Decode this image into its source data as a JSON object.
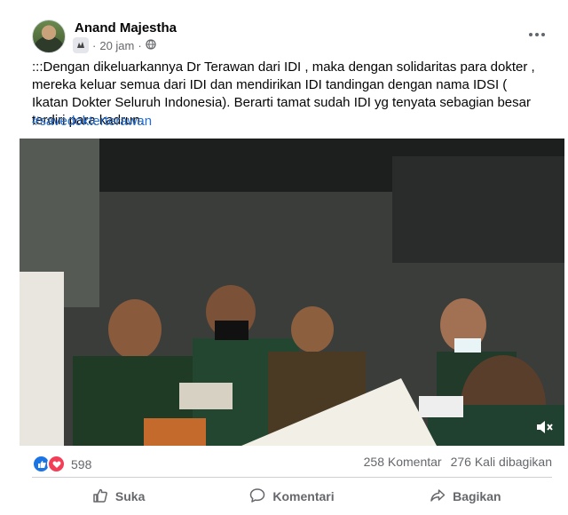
{
  "post": {
    "author": "Anand Majestha",
    "time": "20 jam",
    "separator": "·",
    "text": ":::Dengan dikeluarkannya Dr Terawan dari IDI , maka dengan solidaritas para dokter , mereka keluar semua dari IDI dan mendirikan IDI tandingan dengan nama IDSI ( Ikatan Dokter Seluruh Indonesia). Berarti tamat sudah IDI yg tenyata sebagian besar terdiri para kadrun.",
    "hashtag": "#savedokterterawan"
  },
  "stats": {
    "reactions_count": "598",
    "comments": "258 Komentar",
    "shares": "276 Kali dibagikan"
  },
  "actions": {
    "like": "Suka",
    "comment": "Komentari",
    "share": "Bagikan"
  },
  "colors": {
    "link": "#216fdb",
    "like_blue": "#1b74e4",
    "love_red": "#f33e58",
    "secondary_text": "#65676b"
  }
}
